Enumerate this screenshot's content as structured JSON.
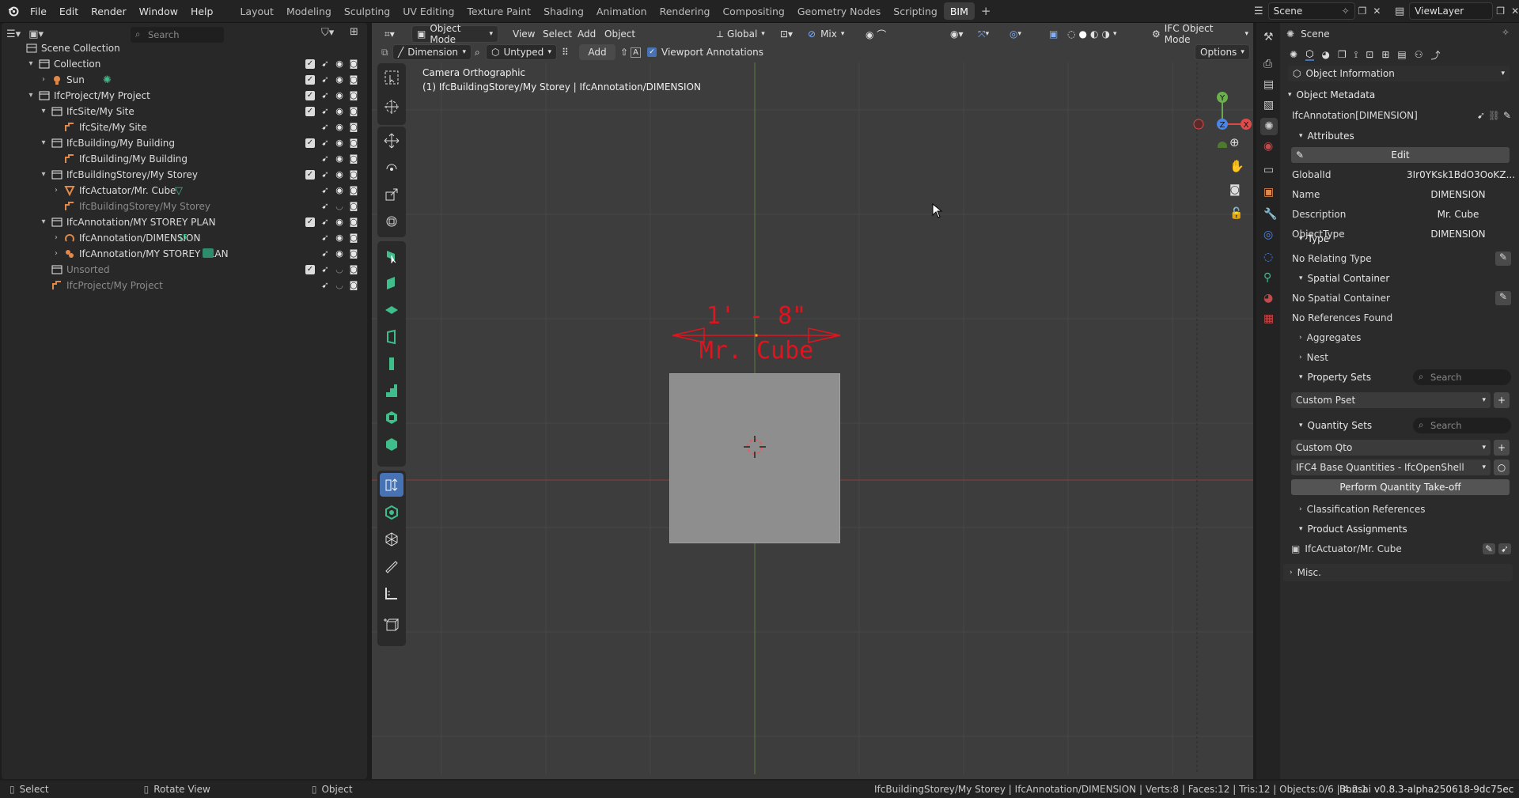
{
  "menu": {
    "items": [
      "File",
      "Edit",
      "Render",
      "Window",
      "Help"
    ]
  },
  "workspaces": {
    "tabs": [
      "Layout",
      "Modeling",
      "Sculpting",
      "UV Editing",
      "Texture Paint",
      "Shading",
      "Animation",
      "Rendering",
      "Compositing",
      "Geometry Nodes",
      "Scripting",
      "BIM"
    ],
    "active": "BIM",
    "add": "+"
  },
  "top_right": {
    "scene": "Scene",
    "viewlayer": "ViewLayer"
  },
  "outliner": {
    "search_placeholder": "Search",
    "rows": [
      {
        "label": "Scene Collection"
      },
      {
        "label": "Collection"
      },
      {
        "label": "Sun"
      },
      {
        "label": "IfcProject/My Project"
      },
      {
        "label": "IfcSite/My Site"
      },
      {
        "label": "IfcSite/My Site"
      },
      {
        "label": "IfcBuilding/My Building"
      },
      {
        "label": "IfcBuilding/My Building"
      },
      {
        "label": "IfcBuildingStorey/My Storey"
      },
      {
        "label": "IfcActuator/Mr. Cube"
      },
      {
        "label": "IfcBuildingStorey/My Storey"
      },
      {
        "label": "IfcAnnotation/MY STOREY PLAN"
      },
      {
        "label": "IfcAnnotation/DIMENSION"
      },
      {
        "label": "IfcAnnotation/MY STOREY PLAN"
      },
      {
        "label": "Unsorted"
      },
      {
        "label": "IfcProject/My Project"
      }
    ]
  },
  "viewport_header": {
    "mode": "Object Mode",
    "menus": [
      "View",
      "Select",
      "Add",
      "Object"
    ],
    "orientation": "Global",
    "snap": "Mix",
    "ifc_mode": "IFC Object Mode",
    "dimension_label": "Dimension",
    "type_label": "Untyped",
    "add_label": "Add",
    "annotations_label": "Viewport Annotations",
    "options": "Options"
  },
  "viewport": {
    "camera_text": "Camera Orthographic",
    "context_text": "(1) IfcBuildingStorey/My Storey | IfcAnnotation/DIMENSION",
    "dimension_value": "1' - 8\"",
    "dimension_desc": "Mr. Cube"
  },
  "properties": {
    "header": "Scene",
    "panel_dropdown": "Object Information",
    "object_metadata": "Object Metadata",
    "object_name": "IfcAnnotation[DIMENSION]",
    "attributes_title": "Attributes",
    "edit_label": "Edit",
    "attributes": [
      {
        "key": "GlobalId",
        "value": "3Ir0YKsk1BdO3OoKZ..."
      },
      {
        "key": "Name",
        "value": "DIMENSION"
      },
      {
        "key": "Description",
        "value": "Mr. Cube"
      },
      {
        "key": "ObjectType",
        "value": "DIMENSION"
      }
    ],
    "type_title": "Type",
    "no_relating_type": "No Relating Type",
    "spatial_title": "Spatial Container",
    "no_spatial": "No Spatial Container",
    "no_references": "No References Found",
    "aggregates": "Aggregates",
    "nest": "Nest",
    "property_sets": "Property Sets",
    "search_placeholder": "Search",
    "custom_pset": "Custom Pset",
    "quantity_sets": "Quantity Sets",
    "custom_qto": "Custom Qto",
    "base_quantities": "IFC4 Base Quantities - IfcOpenShell",
    "takeoff": "Perform Quantity Take-off",
    "classification": "Classification References",
    "product_assignments": "Product Assignments",
    "actuator": "IfcActuator/Mr. Cube",
    "misc": "Misc."
  },
  "status": {
    "select": "Select",
    "rotate": "Rotate View",
    "object": "Object",
    "info": "IfcBuildingStorey/My Storey | IfcAnnotation/DIMENSION | Verts:8 | Faces:12 | Tris:12 | Objects:0/6 | 4.2.1",
    "version": "Bonsai v0.8.3-alpha250618-9dc75ec"
  },
  "colors": {
    "accent": "#4772b3",
    "annotation_red": "#e0141e",
    "ifc_green": "#3fbd8a",
    "orange": "#e0894a"
  }
}
